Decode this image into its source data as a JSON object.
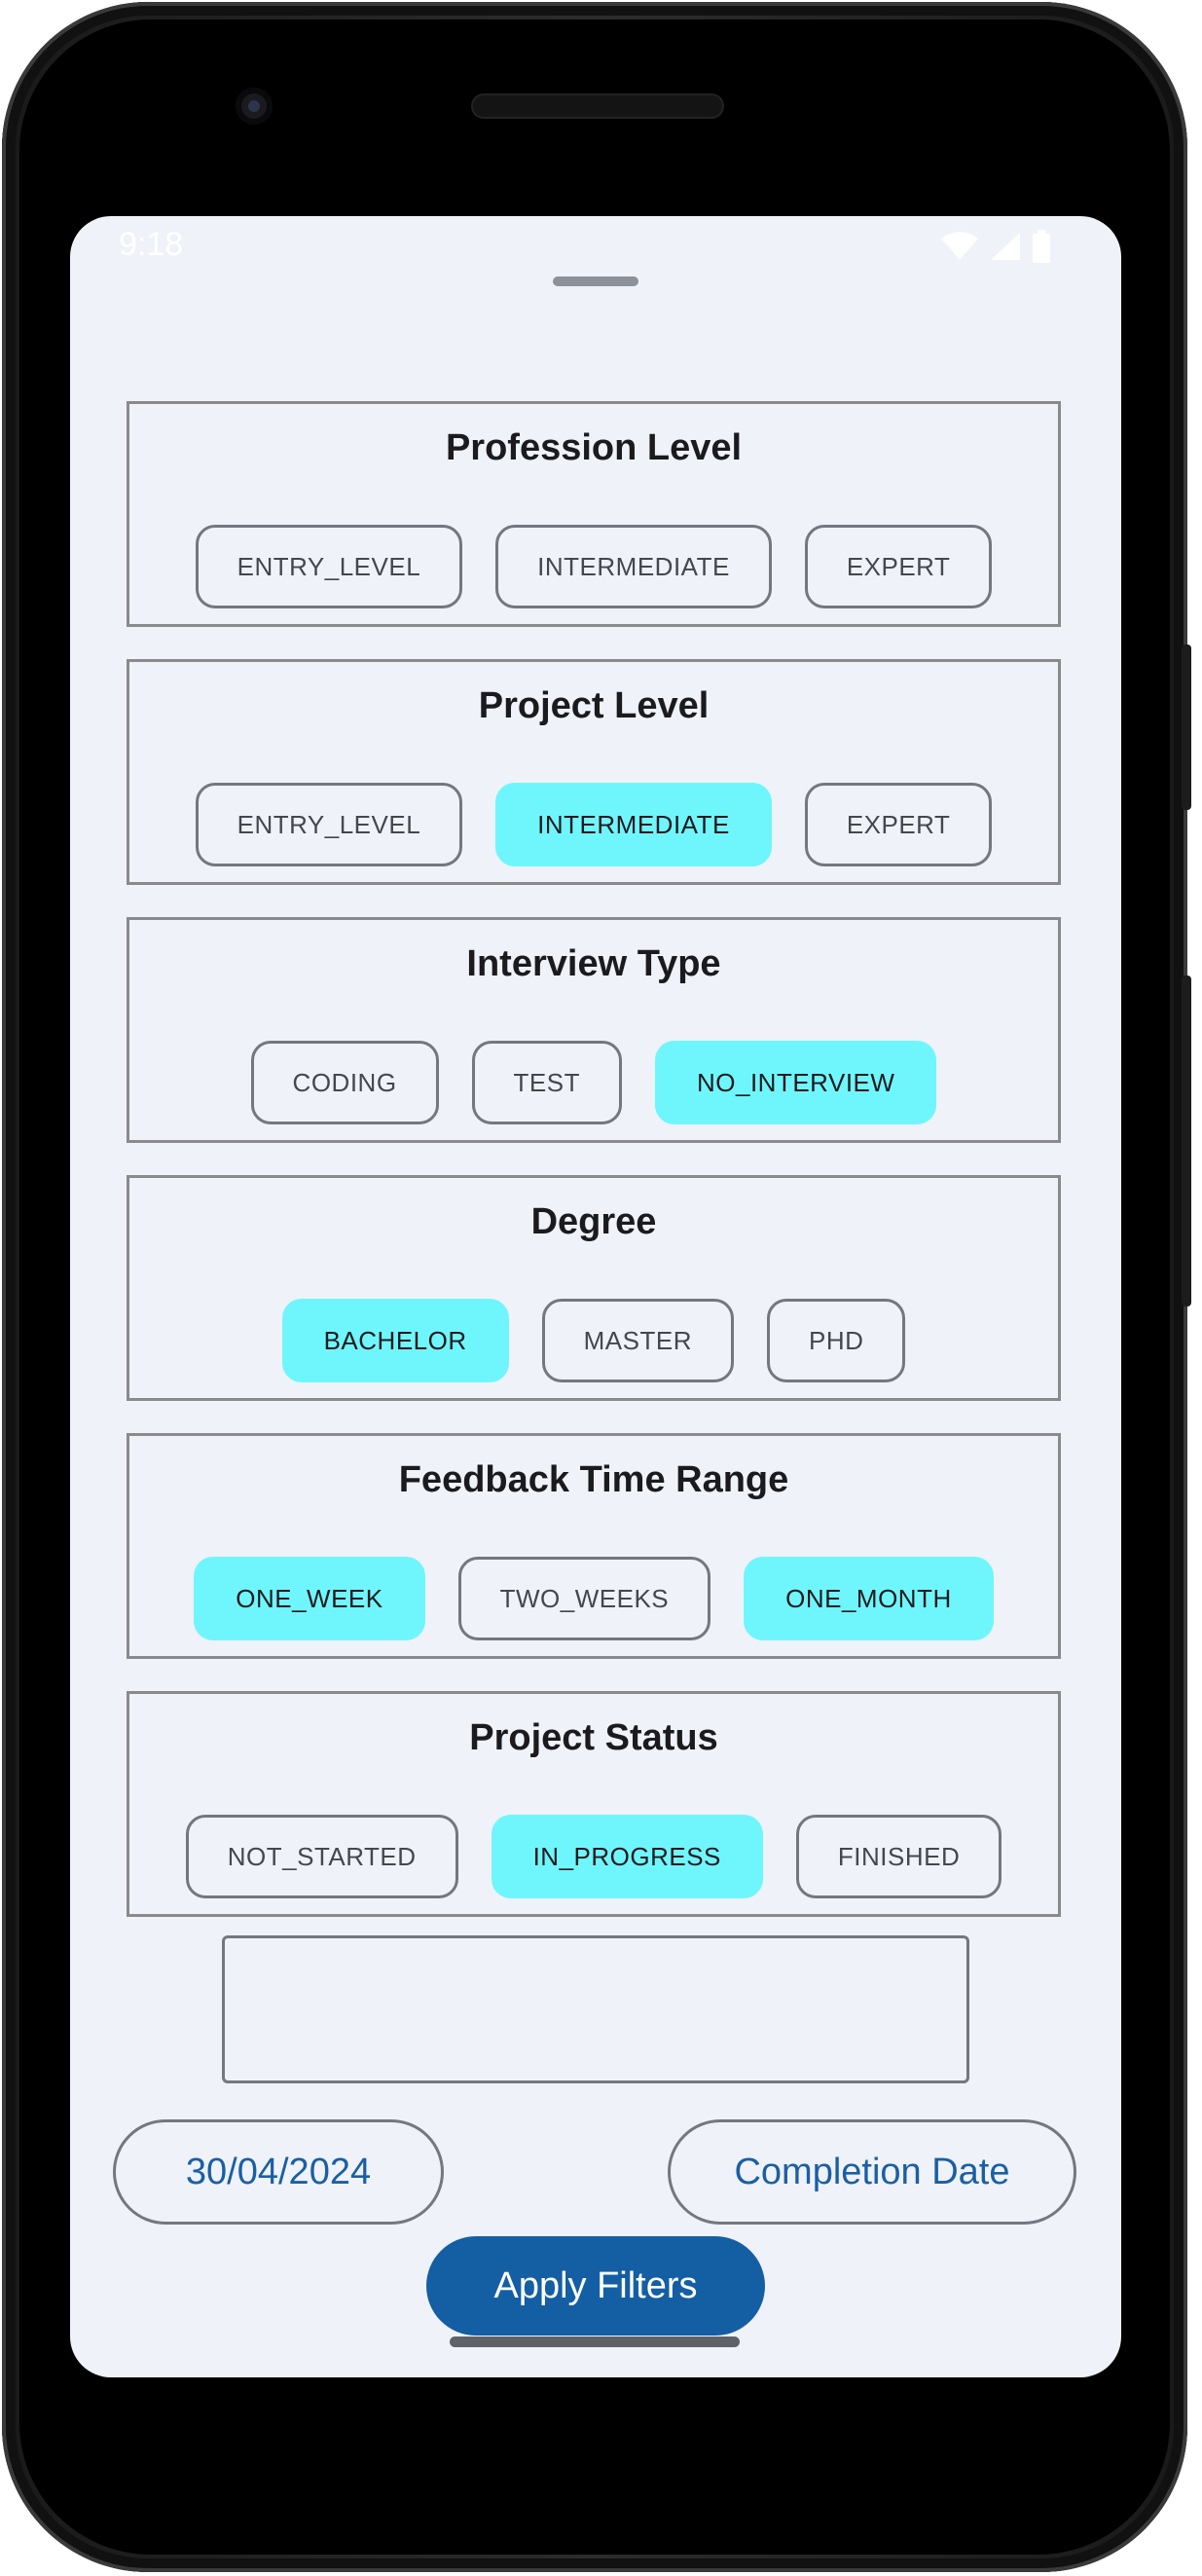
{
  "status_bar": {
    "time": "9:18",
    "icons": [
      "wifi-icon",
      "signal-icon",
      "battery-icon"
    ]
  },
  "sections": [
    {
      "title": "Profession Level",
      "chips": [
        {
          "label": "ENTRY_LEVEL",
          "selected": false
        },
        {
          "label": "INTERMEDIATE",
          "selected": false
        },
        {
          "label": "EXPERT",
          "selected": false
        }
      ]
    },
    {
      "title": "Project Level",
      "chips": [
        {
          "label": "ENTRY_LEVEL",
          "selected": false
        },
        {
          "label": "INTERMEDIATE",
          "selected": true
        },
        {
          "label": "EXPERT",
          "selected": false
        }
      ]
    },
    {
      "title": "Interview Type",
      "chips": [
        {
          "label": "CODING",
          "selected": false
        },
        {
          "label": "TEST",
          "selected": false
        },
        {
          "label": "NO_INTERVIEW",
          "selected": true
        }
      ]
    },
    {
      "title": "Degree",
      "chips": [
        {
          "label": "BACHELOR",
          "selected": true
        },
        {
          "label": "MASTER",
          "selected": false
        },
        {
          "label": "PHD",
          "selected": false
        }
      ]
    },
    {
      "title": "Feedback Time Range",
      "chips": [
        {
          "label": "ONE_WEEK",
          "selected": true
        },
        {
          "label": "TWO_WEEKS",
          "selected": false
        },
        {
          "label": "ONE_MONTH",
          "selected": true
        }
      ]
    },
    {
      "title": "Project Status",
      "chips": [
        {
          "label": "NOT_STARTED",
          "selected": false
        },
        {
          "label": "IN_PROGRESS",
          "selected": true
        },
        {
          "label": "FINISHED",
          "selected": false
        }
      ]
    }
  ],
  "text_input": {
    "value": ""
  },
  "start_date_button": "30/04/2024",
  "completion_date_button": "Completion Date",
  "apply_button": "Apply Filters",
  "colors": {
    "screen_background": "#eff2f9",
    "chip_selected": "#6ff6fc",
    "primary": "#145ea4",
    "link_text": "#1b5fa3"
  }
}
